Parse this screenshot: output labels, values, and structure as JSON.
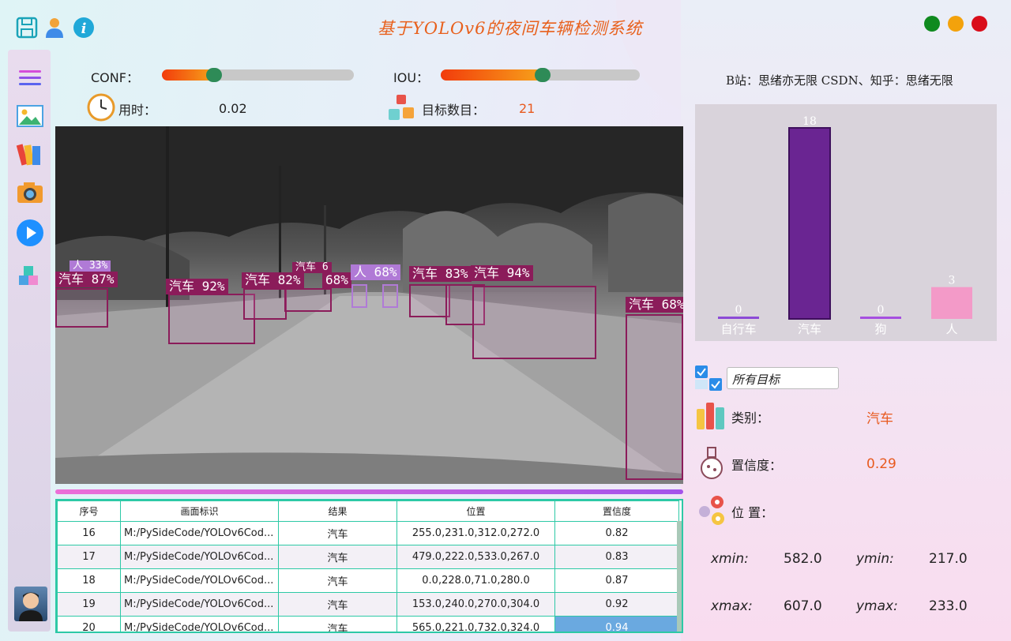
{
  "header": {
    "title": "基于YOLOv6的夜间车辆检测系统",
    "icons": [
      "save-icon",
      "user-icon",
      "info-icon"
    ],
    "window_controls": [
      {
        "name": "maximize",
        "color": "#0f8a1f"
      },
      {
        "name": "minimize",
        "color": "#f3a20c"
      },
      {
        "name": "close",
        "color": "#d90d1a"
      }
    ]
  },
  "credit": "B站：思绪亦无限 CSDN、知乎：思绪无限",
  "sidebar": {
    "items": [
      "menu-icon",
      "image-icon",
      "folder-icon",
      "camera-icon",
      "video-play-icon",
      "model-cube-icon"
    ],
    "avatar": "avatar"
  },
  "controls": {
    "conf_label": "CONF：",
    "conf_value": 0.27,
    "iou_label": "IOU：",
    "iou_value": 0.51,
    "time_label": "用时：",
    "time_value": "0.02",
    "count_label": "目标数目：",
    "count_value": "21"
  },
  "detections": [
    {
      "label": "汽车 87%",
      "cls": "car"
    },
    {
      "label": "汽车 92%",
      "cls": "car"
    },
    {
      "label": "汽车 82%",
      "cls": "car"
    },
    {
      "label": "68%",
      "cls": "car"
    },
    {
      "label": "人 68%",
      "cls": "person"
    },
    {
      "label": "汽车 83%",
      "cls": "car"
    },
    {
      "label": "汽车 94%",
      "cls": "car"
    },
    {
      "label": "汽车 68%",
      "cls": "car"
    },
    {
      "label": "人 33%",
      "cls": "person"
    },
    {
      "label": "汽车 6",
      "cls": "car"
    }
  ],
  "table": {
    "headers": [
      "序号",
      "画面标识",
      "结果",
      "位置",
      "置信度"
    ],
    "rows": [
      [
        "16",
        "M:/PySideCode/YOLOv6Cod...",
        "汽车",
        "255.0,231.0,312.0,272.0",
        "0.82"
      ],
      [
        "17",
        "M:/PySideCode/YOLOv6Cod...",
        "汽车",
        "479.0,222.0,533.0,267.0",
        "0.83"
      ],
      [
        "18",
        "M:/PySideCode/YOLOv6Cod...",
        "汽车",
        "0.0,228.0,71.0,280.0",
        "0.87"
      ],
      [
        "19",
        "M:/PySideCode/YOLOv6Cod...",
        "汽车",
        "153.0,240.0,270.0,304.0",
        "0.92"
      ],
      [
        "20",
        "M:/PySideCode/YOLOv6Cod...",
        "汽车",
        "565.0,221.0,732.0,324.0",
        "0.94"
      ]
    ],
    "selected_row": 4
  },
  "chart_data": {
    "type": "bar",
    "categories": [
      "自行车",
      "汽车",
      "狗",
      "人"
    ],
    "values": [
      0,
      18,
      0,
      3
    ],
    "colors": [
      "#8c4ad6",
      "#6a2592",
      "#a64fe0",
      "#f39ac8"
    ],
    "ylim": [
      0,
      18
    ]
  },
  "details": {
    "filter_value": "所有目标",
    "class_label": "类别：",
    "class_value": "汽车",
    "conf_label": "置信度：",
    "conf_value": "0.29",
    "pos_label": "位 置：",
    "xmin_label": "xmin:",
    "xmin": "582.0",
    "ymin_label": "ymin:",
    "ymin": "217.0",
    "xmax_label": "xmax:",
    "xmax": "607.0",
    "ymax_label": "ymax:",
    "ymax": "233.0"
  }
}
